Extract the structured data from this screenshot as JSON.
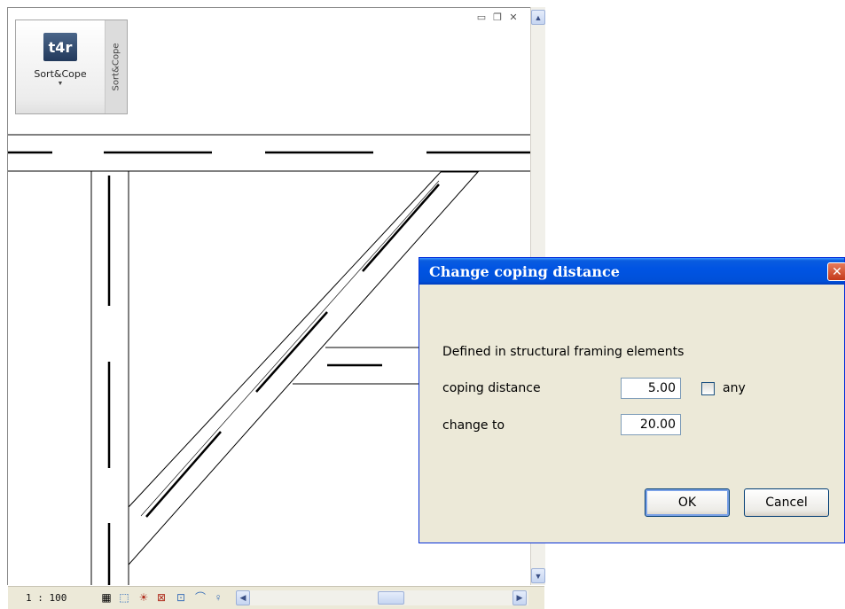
{
  "ribbon": {
    "button_label": "Sort&Cope",
    "logo_text": "t4r",
    "panel_tab_label": "Sort&Cope"
  },
  "window_controls": {
    "minimize_icon": "minimize-icon",
    "restore_icon": "restore-icon",
    "close_icon": "close-icon"
  },
  "status_bar": {
    "scale": "1 : 100",
    "tools": [
      "detail-level-icon",
      "visual-style-icon",
      "sun-path-icon",
      "shadows-icon",
      "crop-view-icon",
      "hide-crop-icon",
      "temporary-hide-icon"
    ]
  },
  "dialog": {
    "title": "Change coping distance",
    "description": "Defined in structural framing elements",
    "coping_distance_label": "coping distance",
    "coping_distance_value": "5.00",
    "any_label": "any",
    "any_checked": false,
    "change_to_label": "change to",
    "change_to_value": "20.00",
    "ok_label": "OK",
    "cancel_label": "Cancel"
  },
  "colors": {
    "dialog_title_bar": "#0054e3",
    "dialog_background": "#ece9d8",
    "ribbon_logo": "#2b4468"
  }
}
